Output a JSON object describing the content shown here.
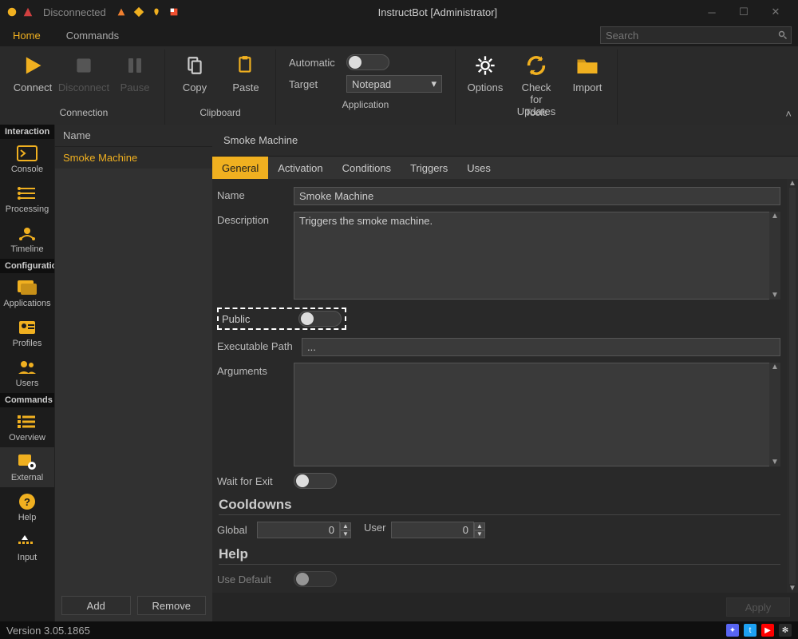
{
  "window": {
    "title": "InstructBot [Administrator]",
    "status": "Disconnected"
  },
  "menuTabs": {
    "home": "Home",
    "commands": "Commands",
    "active": "Home"
  },
  "search": {
    "placeholder": "Search"
  },
  "ribbon": {
    "connection": {
      "label": "Connection",
      "connect": "Connect",
      "disconnect": "Disconnect",
      "pause": "Pause"
    },
    "clipboard": {
      "label": "Clipboard",
      "copy": "Copy",
      "paste": "Paste"
    },
    "application": {
      "label": "Application",
      "automatic": "Automatic",
      "target": "Target",
      "targetValue": "Notepad"
    },
    "tools": {
      "label": "Tools",
      "options": "Options",
      "check": "Check for Updates",
      "import": "Import"
    }
  },
  "sidebar": {
    "sections": {
      "interaction": "Interaction",
      "configuration": "Configuration",
      "commands": "Commands"
    },
    "items": {
      "console": "Console",
      "processing": "Processing",
      "timeline": "Timeline",
      "applications": "Applications",
      "profiles": "Profiles",
      "users": "Users",
      "overview": "Overview",
      "external": "External",
      "help": "Help",
      "input": "Input"
    }
  },
  "list": {
    "header": "Name",
    "items": [
      "Smoke Machine"
    ],
    "add": "Add",
    "remove": "Remove"
  },
  "detail": {
    "title": "Smoke Machine",
    "tabs": {
      "general": "General",
      "activation": "Activation",
      "conditions": "Conditions",
      "triggers": "Triggers",
      "uses": "Uses"
    },
    "fields": {
      "nameLabel": "Name",
      "nameValue": "Smoke Machine",
      "descLabel": "Description",
      "descValue": "Triggers the smoke machine.",
      "publicLabel": "Public",
      "execLabel": "Executable Path",
      "execValue": "...",
      "argsLabel": "Arguments",
      "argsValue": "",
      "waitLabel": "Wait for Exit",
      "cooldowns": "Cooldowns",
      "globalLabel": "Global",
      "globalValue": "0",
      "userLabel": "User",
      "userValue": "0",
      "help": "Help",
      "useDefaultLabel": "Use Default"
    },
    "apply": "Apply"
  },
  "status": {
    "version": "Version 3.05.1865"
  },
  "colors": {
    "accent": "#f0b020",
    "bg": "#1e1e1e"
  }
}
